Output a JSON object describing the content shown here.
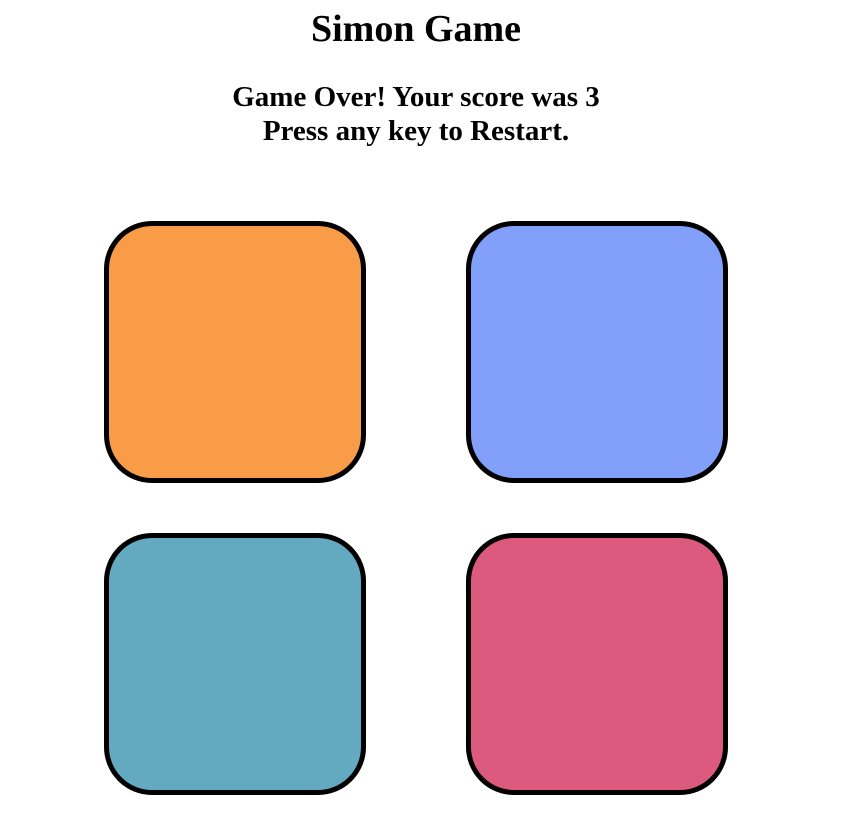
{
  "header": {
    "title": "Simon Game"
  },
  "status": {
    "line1": "Game Over! Your score was 3",
    "line2": "Press any key to Restart."
  },
  "pads": [
    {
      "name": "orange",
      "color": "#F89C47"
    },
    {
      "name": "blue",
      "color": "#82A0F9"
    },
    {
      "name": "teal",
      "color": "#63A9BF"
    },
    {
      "name": "pink",
      "color": "#DB5A7D"
    }
  ]
}
